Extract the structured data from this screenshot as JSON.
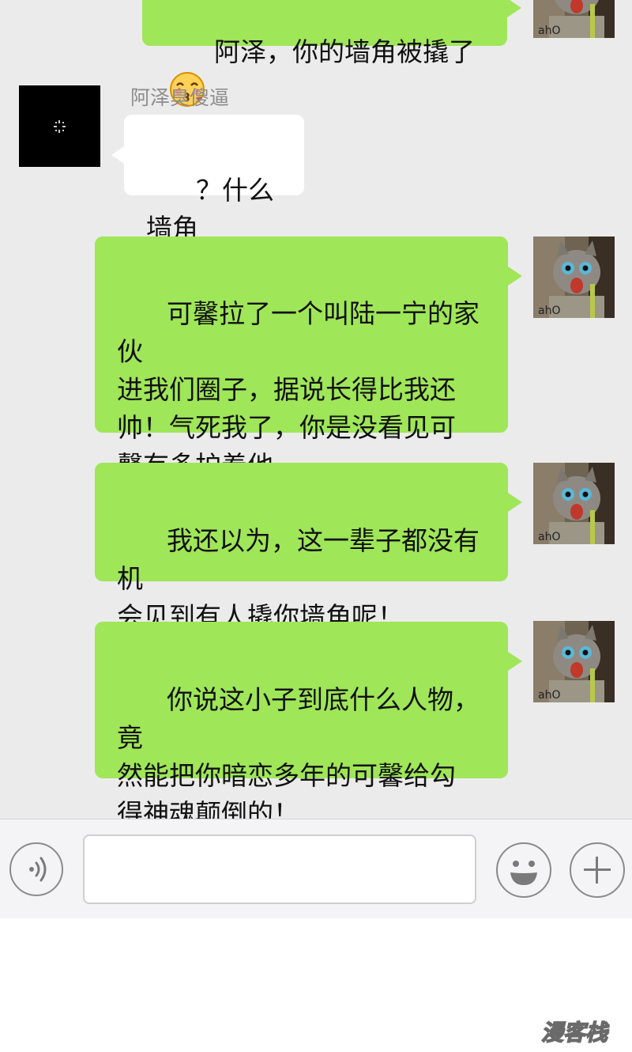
{
  "chat": {
    "messages": [
      {
        "direction": "out",
        "text": "阿泽，你的墙角被撬了",
        "emoji": "blush-kiss-emoji"
      },
      {
        "direction": "in",
        "sender": "阿泽臭傻逼",
        "text": "？什么墙角"
      },
      {
        "direction": "out",
        "text": "可馨拉了一个叫陆一宁的家伙\n进我们圈子，据说长得比我还\n帅！气死我了，你是没看见可\n馨有多护着他"
      },
      {
        "direction": "out",
        "text": "我还以为，这一辈子都没有机\n会见到有人撬你墙角呢！"
      },
      {
        "direction": "out",
        "text": "你说这小子到底什么人物，竟\n然能把你暗恋多年的可馨给勾\n得神魂颠倒的！"
      }
    ]
  },
  "input_bar": {
    "voice_icon": "voice-wave-icon",
    "emoji_icon": "smiley-icon",
    "plus_icon": "plus-icon",
    "text_value": ""
  },
  "colors": {
    "outgoing_bubble": "#9fe658",
    "incoming_bubble": "#ffffff",
    "chat_background": "#ebebeb",
    "sender_name": "#8c8c8c"
  },
  "watermark": "漫客栈"
}
